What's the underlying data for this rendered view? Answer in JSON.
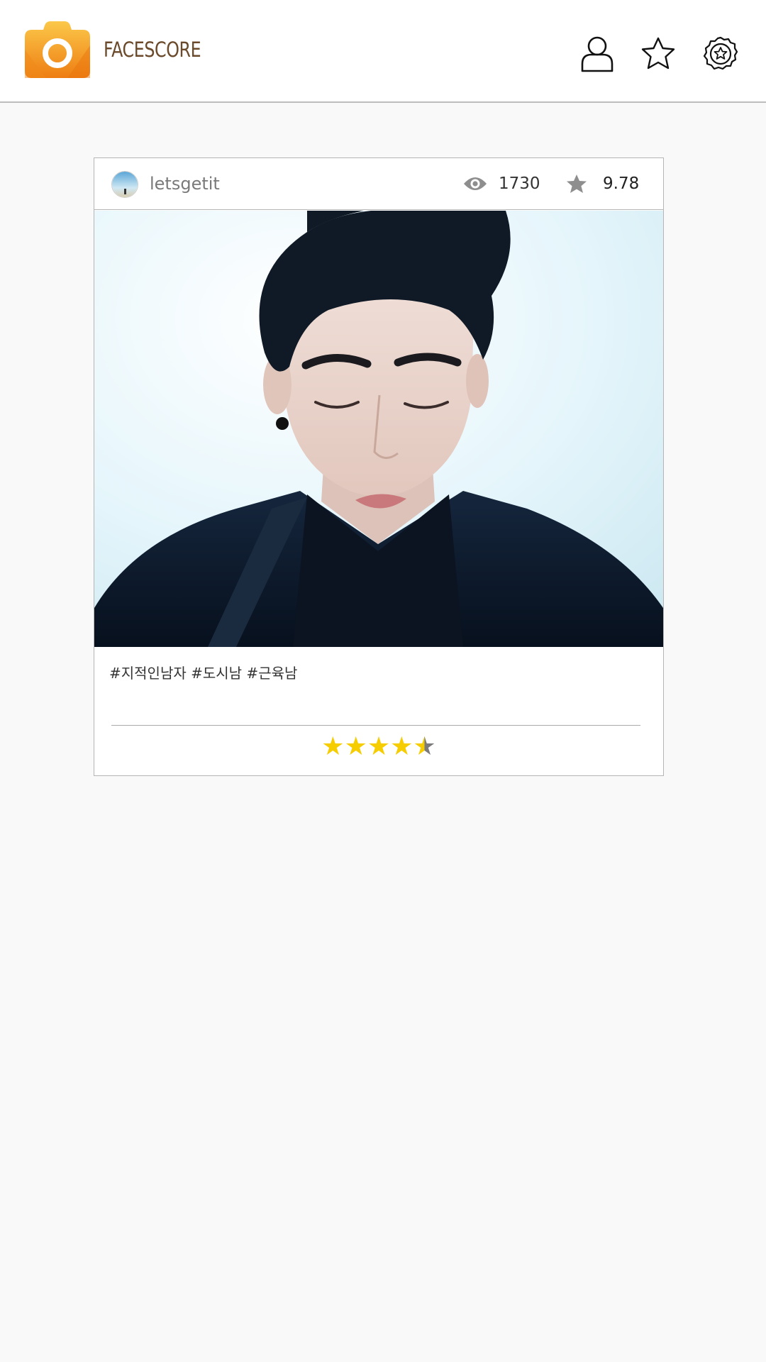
{
  "app": {
    "title": "FACESCORE",
    "accent_color": "#f5a623",
    "title_color": "#6b4a2b"
  },
  "header": {
    "icons": [
      "camera-logo-icon",
      "profile-icon",
      "star-outline-icon",
      "badge-icon"
    ]
  },
  "post": {
    "username": "letsgetit",
    "views": "1730",
    "score": "9.78",
    "hashtags": "#지적인남자 #도시남 #근육남",
    "rating": 4.5,
    "rating_max": 5,
    "star_color": "#f5cd00",
    "icons": [
      "eye-icon",
      "star-filled-icon"
    ]
  }
}
